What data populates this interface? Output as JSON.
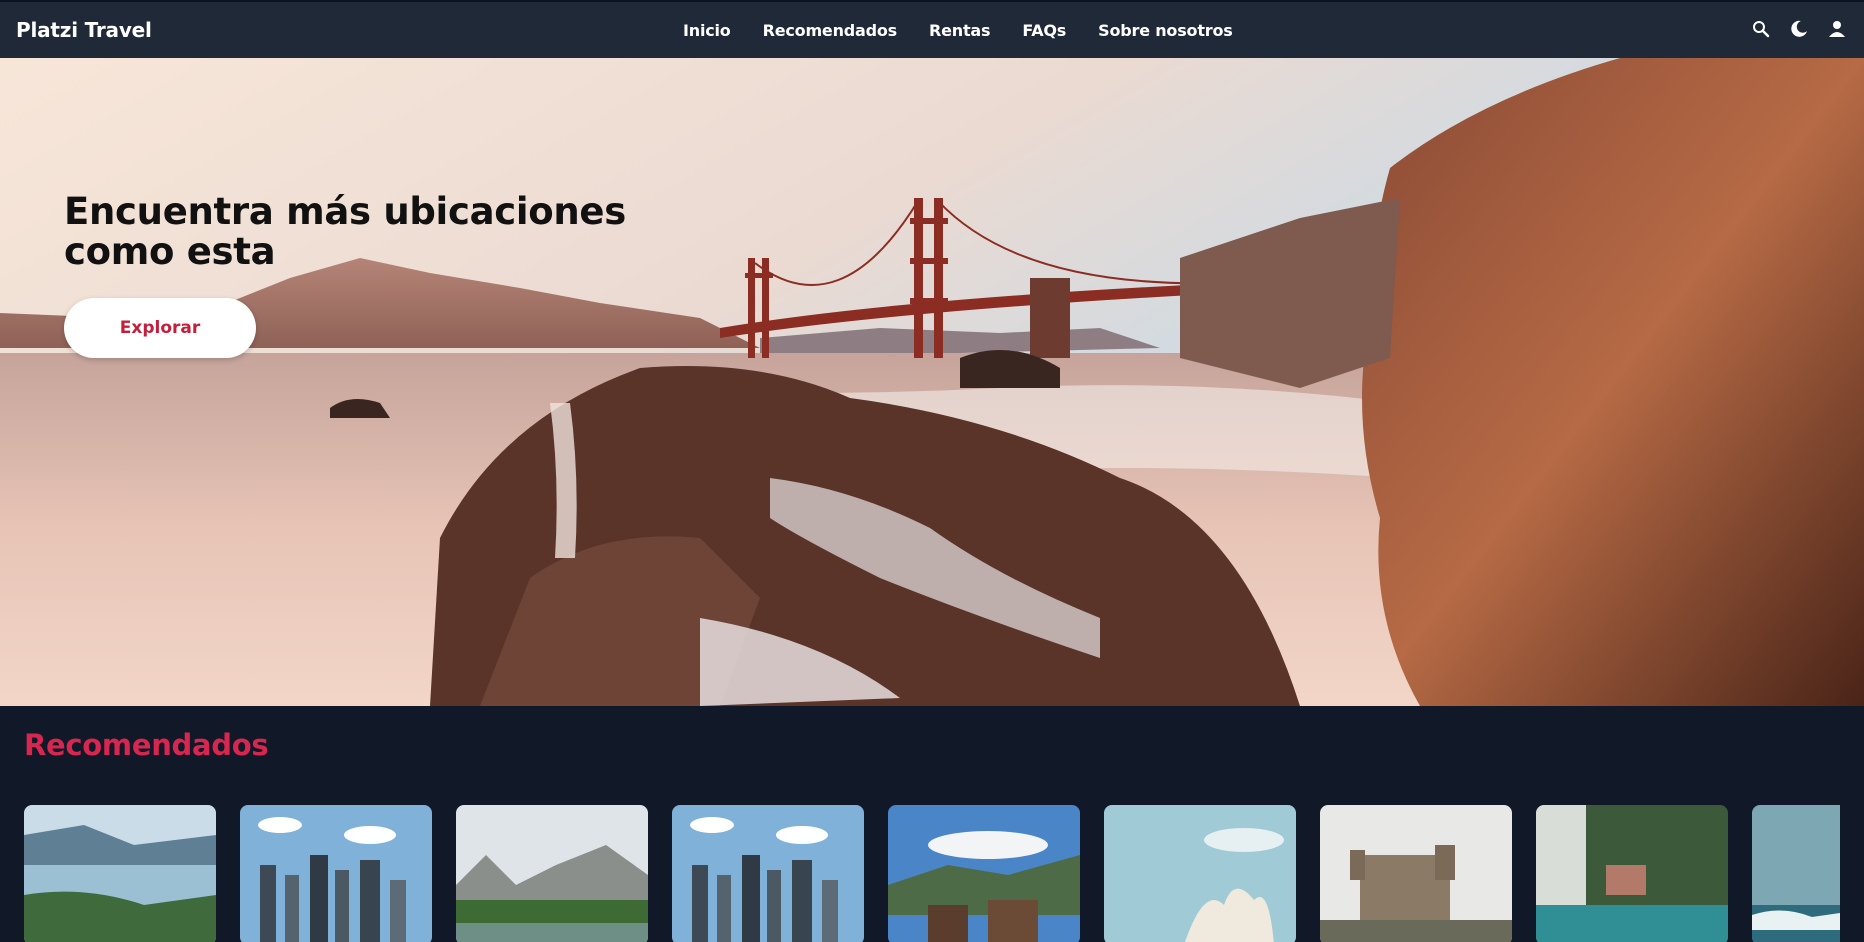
{
  "app": {
    "brand": "Platzi Travel"
  },
  "nav": {
    "links": [
      "Inicio",
      "Recomendados",
      "Rentas",
      "FAQs",
      "Sobre nosotros"
    ]
  },
  "icons": [
    "search-icon",
    "moon-icon",
    "user-icon"
  ],
  "hero": {
    "title": "Encuentra más ubicaciones como esta",
    "button_label": "Explorar"
  },
  "recommended": {
    "title": "Recomendados",
    "cards": [
      "lake-valley",
      "city-skyline",
      "mountain-valley",
      "city-skyline",
      "alpine-village",
      "opera-house",
      "castle",
      "villa-pool",
      "beach"
    ]
  },
  "colors": {
    "nav_bg": "#1f2937",
    "page_bg": "#111827",
    "accent": "#d7264f"
  }
}
